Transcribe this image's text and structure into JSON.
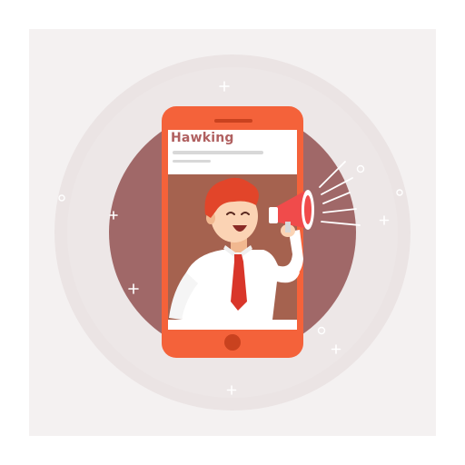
{
  "phone_screen": {
    "headline": "Hawking"
  },
  "colors": {
    "backdrop": "#f4f1f1",
    "halo": "#ebe4e4",
    "disc": "#a06868",
    "phone_body": "#f4623a",
    "screen_bg": "#ffffff",
    "headline": "#b06060",
    "placeholder_lines": "#d8d8d8",
    "hair": "#e2452a",
    "skin": "#fbd3b4",
    "shirt": "#ffffff",
    "tie": "#d9362a",
    "megaphone": "#f04b4b",
    "sparkle": "#ffffff"
  },
  "icons": [
    "megaphone-icon",
    "sparkle-icon",
    "home-button-icon",
    "speaker-slot-icon"
  ]
}
